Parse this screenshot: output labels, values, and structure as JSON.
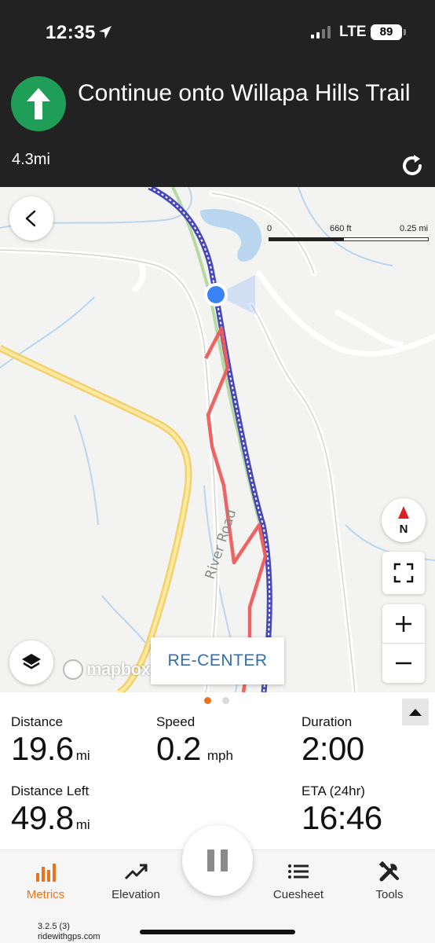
{
  "status_bar": {
    "time": "12:35",
    "network": "LTE",
    "battery": "89"
  },
  "navigation": {
    "instruction": "Continue onto Willapa Hills Trail",
    "distance_to_turn": "4.3mi",
    "turn_icon": "arrow-up-icon",
    "accent_color": "#1e9e57"
  },
  "map": {
    "scale": {
      "start": "0",
      "mid": "660 ft",
      "end": "0.25 mi"
    },
    "road_label": "River Road",
    "recenter_label": "RE-CENTER",
    "attribution": "mapbox",
    "compass_label": "N"
  },
  "metrics": {
    "distance": {
      "label": "Distance",
      "value": "19.6",
      "unit": "mi"
    },
    "speed": {
      "label": "Speed",
      "value": "0.2",
      "unit": "mph"
    },
    "duration": {
      "label": "Duration",
      "value": "2:00"
    },
    "distance_left": {
      "label": "Distance Left",
      "value": "49.8",
      "unit": "mi"
    },
    "eta": {
      "label": "ETA (24hr)",
      "value": "16:46"
    }
  },
  "tabs": [
    {
      "label": "Metrics",
      "icon": "bar-chart-icon",
      "active": true
    },
    {
      "label": "Elevation",
      "icon": "trend-up-icon"
    },
    {
      "label": "Cuesheet",
      "icon": "list-icon"
    },
    {
      "label": "Tools",
      "icon": "tools-icon"
    }
  ],
  "footer": {
    "version": "3.2.5 (3)",
    "site": "ridewithgps.com"
  },
  "colors": {
    "header_bg": "#222222",
    "brand_orange": "#e8741e",
    "route_red": "#ef5b5b",
    "location_blue": "#3b82f6"
  }
}
